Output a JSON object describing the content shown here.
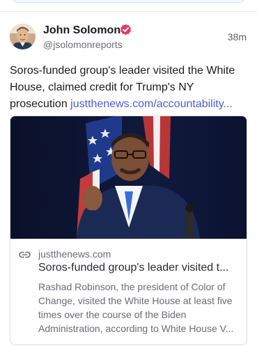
{
  "post": {
    "author_name": "John Solomon",
    "author_handle": "@jsolomonreports",
    "timestamp": "38m",
    "text": "Soros-funded group's leader visited the White House, claimed credit for Trump's NY prosecution ",
    "link_text": "justthenews.com/accountability...",
    "card": {
      "domain": "justthenews.com",
      "title": "Soros-funded group's leader visited t...",
      "description": "Rashad Robinson, the president of Color of Change, visited the White House at least five times over the course of the Biden Administration, according to White House V..."
    }
  },
  "colors": {
    "accent_link": "#4d5fd1",
    "verified_badge": "#e23b63"
  },
  "icons": {
    "verified": "verified-badge-icon",
    "link": "link-icon"
  }
}
